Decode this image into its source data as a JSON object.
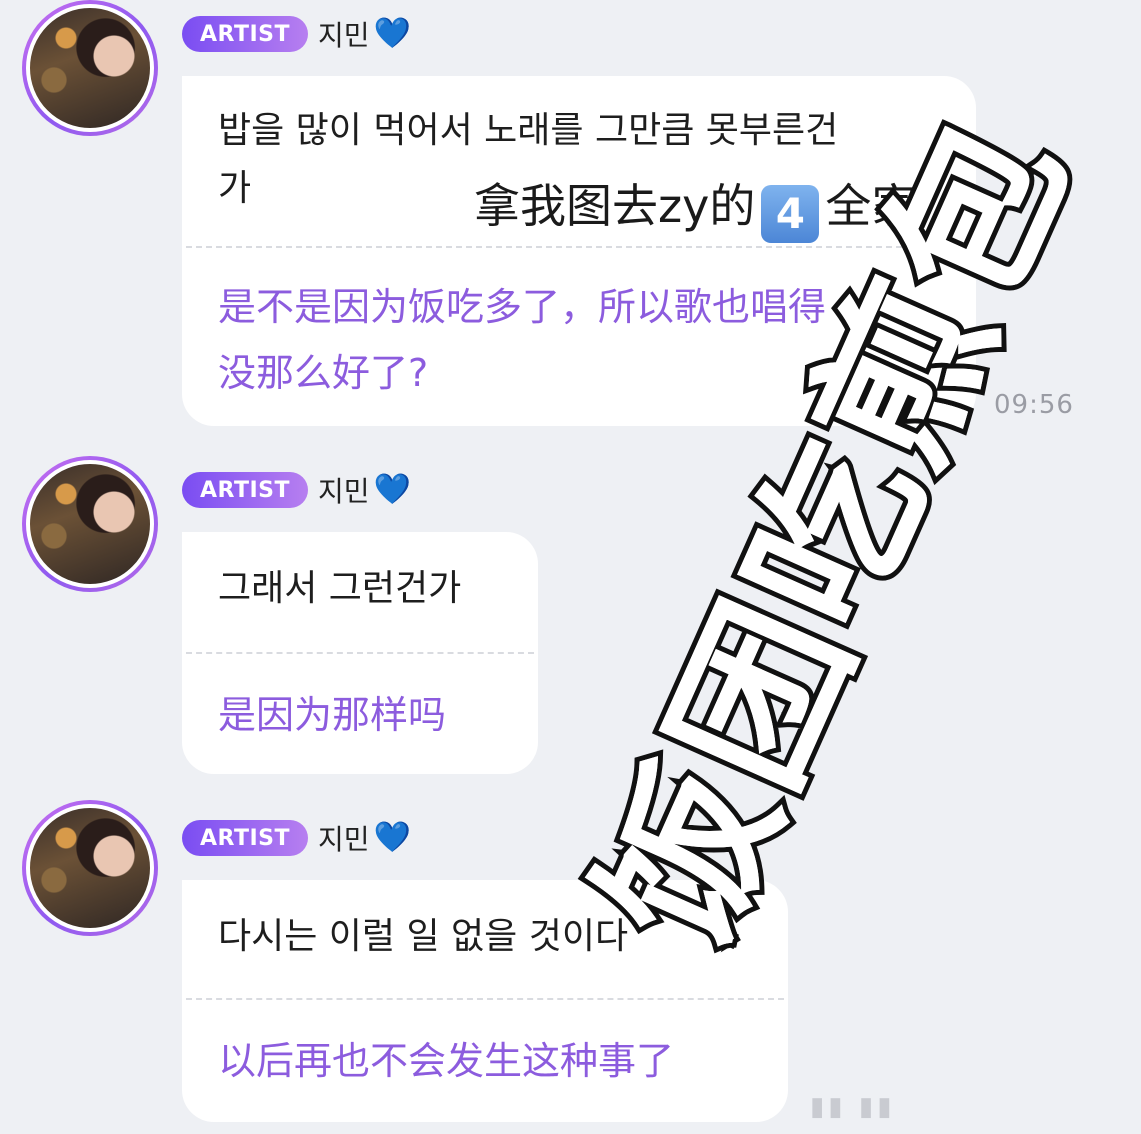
{
  "messages": [
    {
      "badge": "ARTIST",
      "name": "지민",
      "heart": "💙",
      "korean": [
        "밥을 많이 먹어서 노래를 그만큼 못부른건",
        "가"
      ],
      "chinese": [
        "是不是因为饭吃多了，所以歌也唱得",
        "没那么好了?"
      ],
      "time": "09:56"
    },
    {
      "badge": "ARTIST",
      "name": "지민",
      "heart": "💙",
      "korean": [
        "그래서 그런건가"
      ],
      "chinese": [
        "是因为那样吗"
      ]
    },
    {
      "badge": "ARTIST",
      "name": "지민",
      "heart": "💙",
      "korean": [
        "다시는 이럴 일 없을 것이다"
      ],
      "chinese": [
        "以后再也不会发生这种事了"
      ]
    }
  ],
  "overlay": {
    "caption_before": "拿我图去zy的",
    "caption_emoji": "4",
    "caption_after": "全家",
    "watermark": "饭团吃煎包"
  },
  "colors": {
    "background": "#eef0f4",
    "badge": "#7a4df2",
    "translation_text": "#8c5cde",
    "heart": "#6ec6f2"
  },
  "icons": [
    "avatar-photo",
    "blue-heart-icon",
    "keycap-4-emoji"
  ]
}
